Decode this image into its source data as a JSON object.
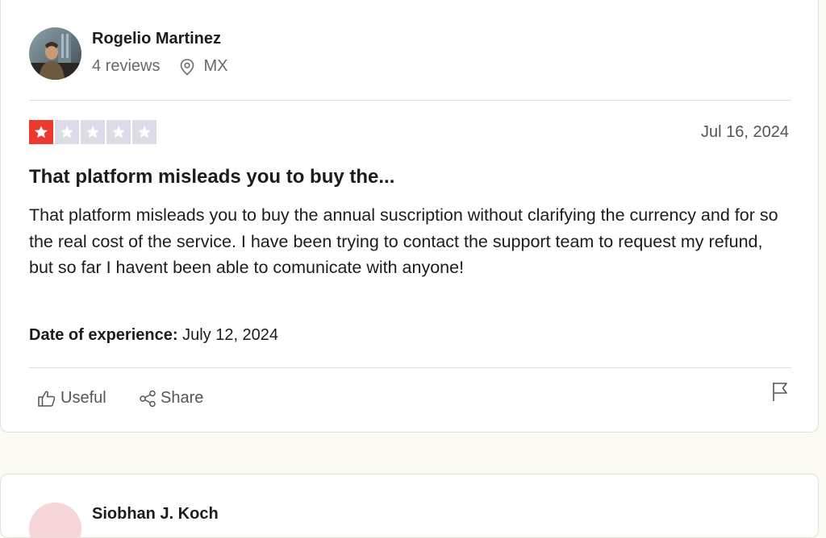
{
  "review": {
    "author": {
      "name": "Rogelio Martinez",
      "reviews_count": "4 reviews",
      "location": "MX"
    },
    "rating": 1,
    "rating_max": 5,
    "date": "Jul 16, 2024",
    "title": "That platform misleads you to buy the...",
    "body": "That platform misleads you to buy the annual suscription without clarifying the currency and for so the real cost of the service. I have been trying to contact the support team to request my refund, but so far I havent been able to comunicate with anyone!",
    "experience_label": "Date of experience:",
    "experience_date": "July 12, 2024",
    "actions": {
      "useful_label": "Useful",
      "share_label": "Share"
    }
  },
  "next_review": {
    "author_name": "Siobhan J. Koch"
  },
  "colors": {
    "star_active": "#ee3a2e",
    "star_inactive": "#dcdce6",
    "page_background": "#fcfbf3"
  }
}
